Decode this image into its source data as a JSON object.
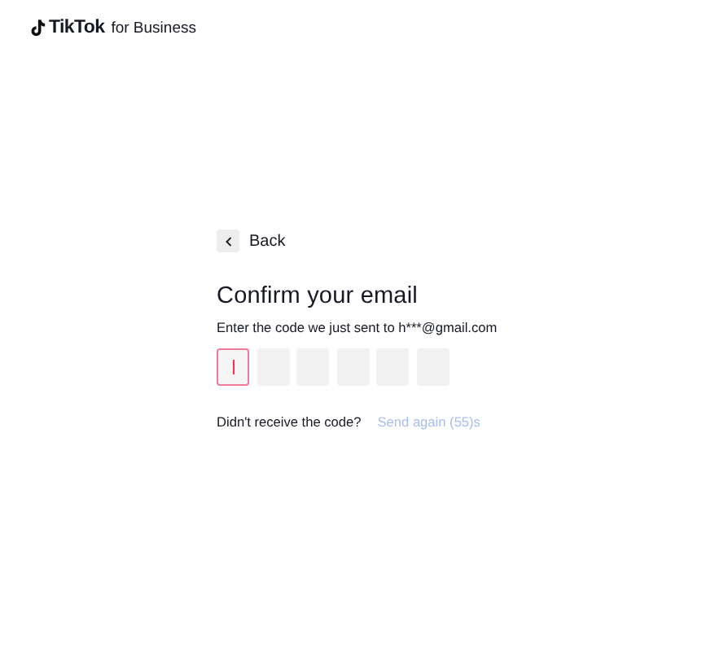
{
  "header": {
    "logo": {
      "brand": "TikTok",
      "suffix": "for Business"
    }
  },
  "back_button": {
    "label": "Back"
  },
  "title": "Confirm your email",
  "subtitle": "Enter the code we just sent to h***@gmail.com",
  "code_boxes": [
    {
      "focused": true
    },
    {
      "focused": false
    },
    {
      "focused": false
    },
    {
      "focused": false
    },
    {
      "focused": false
    },
    {
      "focused": false
    }
  ],
  "resend": {
    "prompt": "Didn't receive the code?",
    "link": "Send again (55)s",
    "disabled": true
  }
}
